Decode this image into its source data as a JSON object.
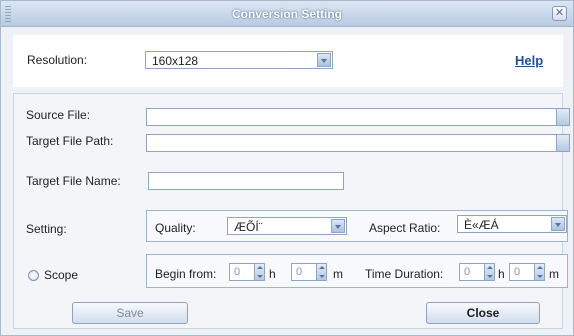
{
  "window": {
    "title": "Conversion Setting"
  },
  "top": {
    "resolution_label": "Resolution:",
    "resolution_value": "160x128",
    "help_link": "Help"
  },
  "files": {
    "source_label": "Source File:",
    "source_value": "",
    "target_path_label": "Target File Path:",
    "target_path_value": "",
    "target_name_label": "Target File Name:",
    "target_name_value": ""
  },
  "setting": {
    "label": "Setting:",
    "quality_label": "Quality:",
    "quality_value": "ÆÕÍ¨",
    "aspect_label": "Aspect Ratio:",
    "aspect_value": "È«ÆÁ"
  },
  "scope": {
    "label": "Scope",
    "begin_label": "Begin from:",
    "begin_h_value": "0",
    "h_unit": "h",
    "begin_m_value": "0",
    "m_unit": "m",
    "duration_label": "Time Duration:",
    "duration_h_value": "0",
    "duration_h_unit": "h",
    "duration_m_value": "0",
    "duration_m_unit": "m"
  },
  "buttons": {
    "save": "Save",
    "close": "Close"
  }
}
